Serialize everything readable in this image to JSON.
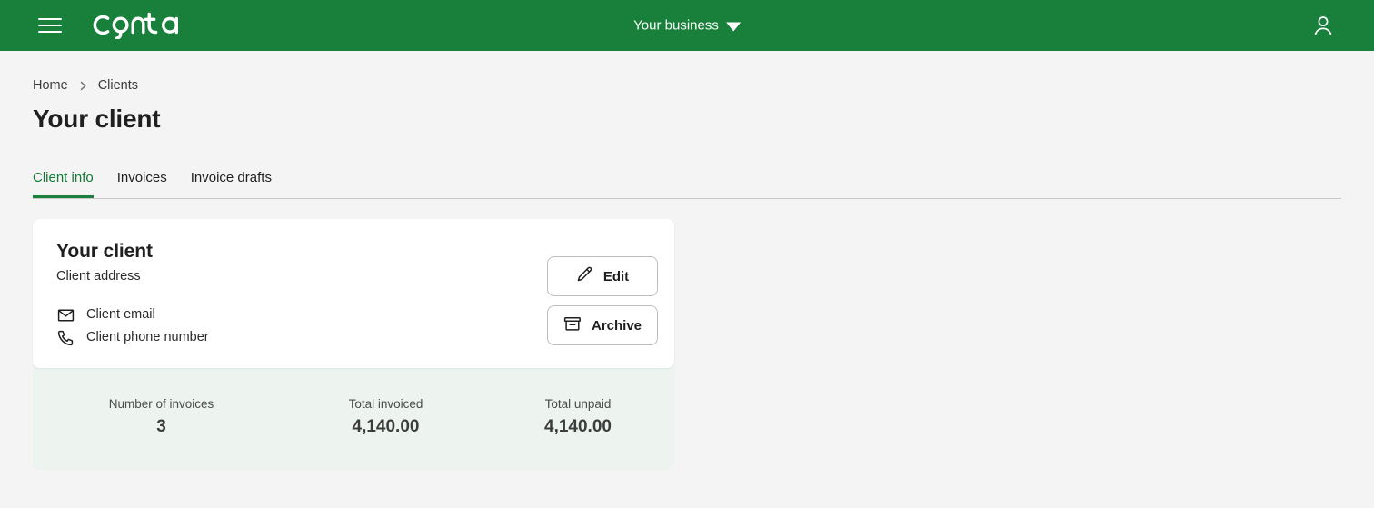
{
  "appbar": {
    "menu_icon": "hamburger-menu-icon",
    "logo_text": "conta",
    "business_switcher_label": "Your business",
    "business_switcher_icon": "chevron-down-icon",
    "account_icon": "user-account-icon"
  },
  "breadcrumb": {
    "items": [
      {
        "label": "Home"
      },
      {
        "label": "Clients"
      }
    ],
    "separator_icon": "chevron-right-icon"
  },
  "page": {
    "title": "Your client"
  },
  "tabs": [
    {
      "label": "Client info",
      "active": true
    },
    {
      "label": "Invoices",
      "active": false
    },
    {
      "label": "Invoice drafts",
      "active": false
    }
  ],
  "client_card": {
    "name": "Your client",
    "address": "Client address",
    "email": "Client email",
    "email_icon": "envelope-icon",
    "phone": "Client phone number",
    "phone_icon": "phone-icon",
    "buttons": [
      {
        "label": "Edit",
        "icon": "pencil-icon"
      },
      {
        "label": "Archive",
        "icon": "archive-box-icon"
      }
    ]
  },
  "stats": [
    {
      "label": "Number of invoices",
      "value": "3"
    },
    {
      "label": "Total invoiced",
      "value": "4,140.00"
    },
    {
      "label": "Total unpaid",
      "value": "4,140.00"
    }
  ],
  "colors": {
    "brand_green": "#18803B",
    "active_tab_green": "#127A38",
    "page_background": "#f4f4f4",
    "card_background": "#ffffff",
    "stats_background": "#EDF4F0"
  }
}
